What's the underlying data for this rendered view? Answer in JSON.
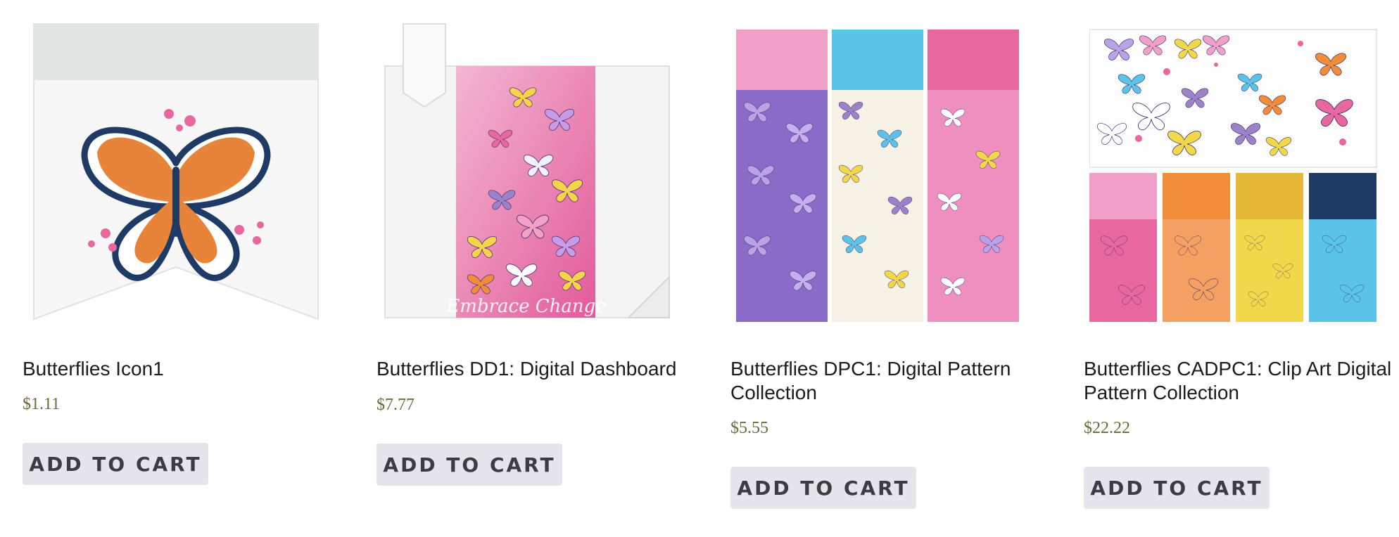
{
  "products": [
    {
      "title": "Butterflies Icon1",
      "price": "$1.11",
      "button_label": "ADD TO CART",
      "image_icon": "butterfly-banner-icon"
    },
    {
      "title": "Butterflies DD1: Digital Dashboard",
      "price": "$7.77",
      "button_label": "ADD TO CART",
      "image_icon": "butterfly-dashboard-card",
      "image_text": "Embrace Change"
    },
    {
      "title": "Butterflies DPC1: Digital Pattern Collection",
      "price": "$5.55",
      "button_label": "ADD TO CART",
      "image_icon": "butterfly-pattern-strips"
    },
    {
      "title": "Butterflies CADPC1: Clip Art Digital Pattern Collection",
      "price": "$22.22",
      "button_label": "ADD TO CART",
      "image_icon": "butterfly-clipart-patterns"
    }
  ],
  "colors": {
    "price": "#6d6a3a",
    "button_bg": "#e6e5ec",
    "button_text": "#3c3c42",
    "orange": "#e8843a",
    "navy": "#1e3b66",
    "pink": "#e8679f",
    "lilac": "#9b82c9",
    "sky": "#5bc3e8",
    "yellow": "#f0d84a"
  }
}
